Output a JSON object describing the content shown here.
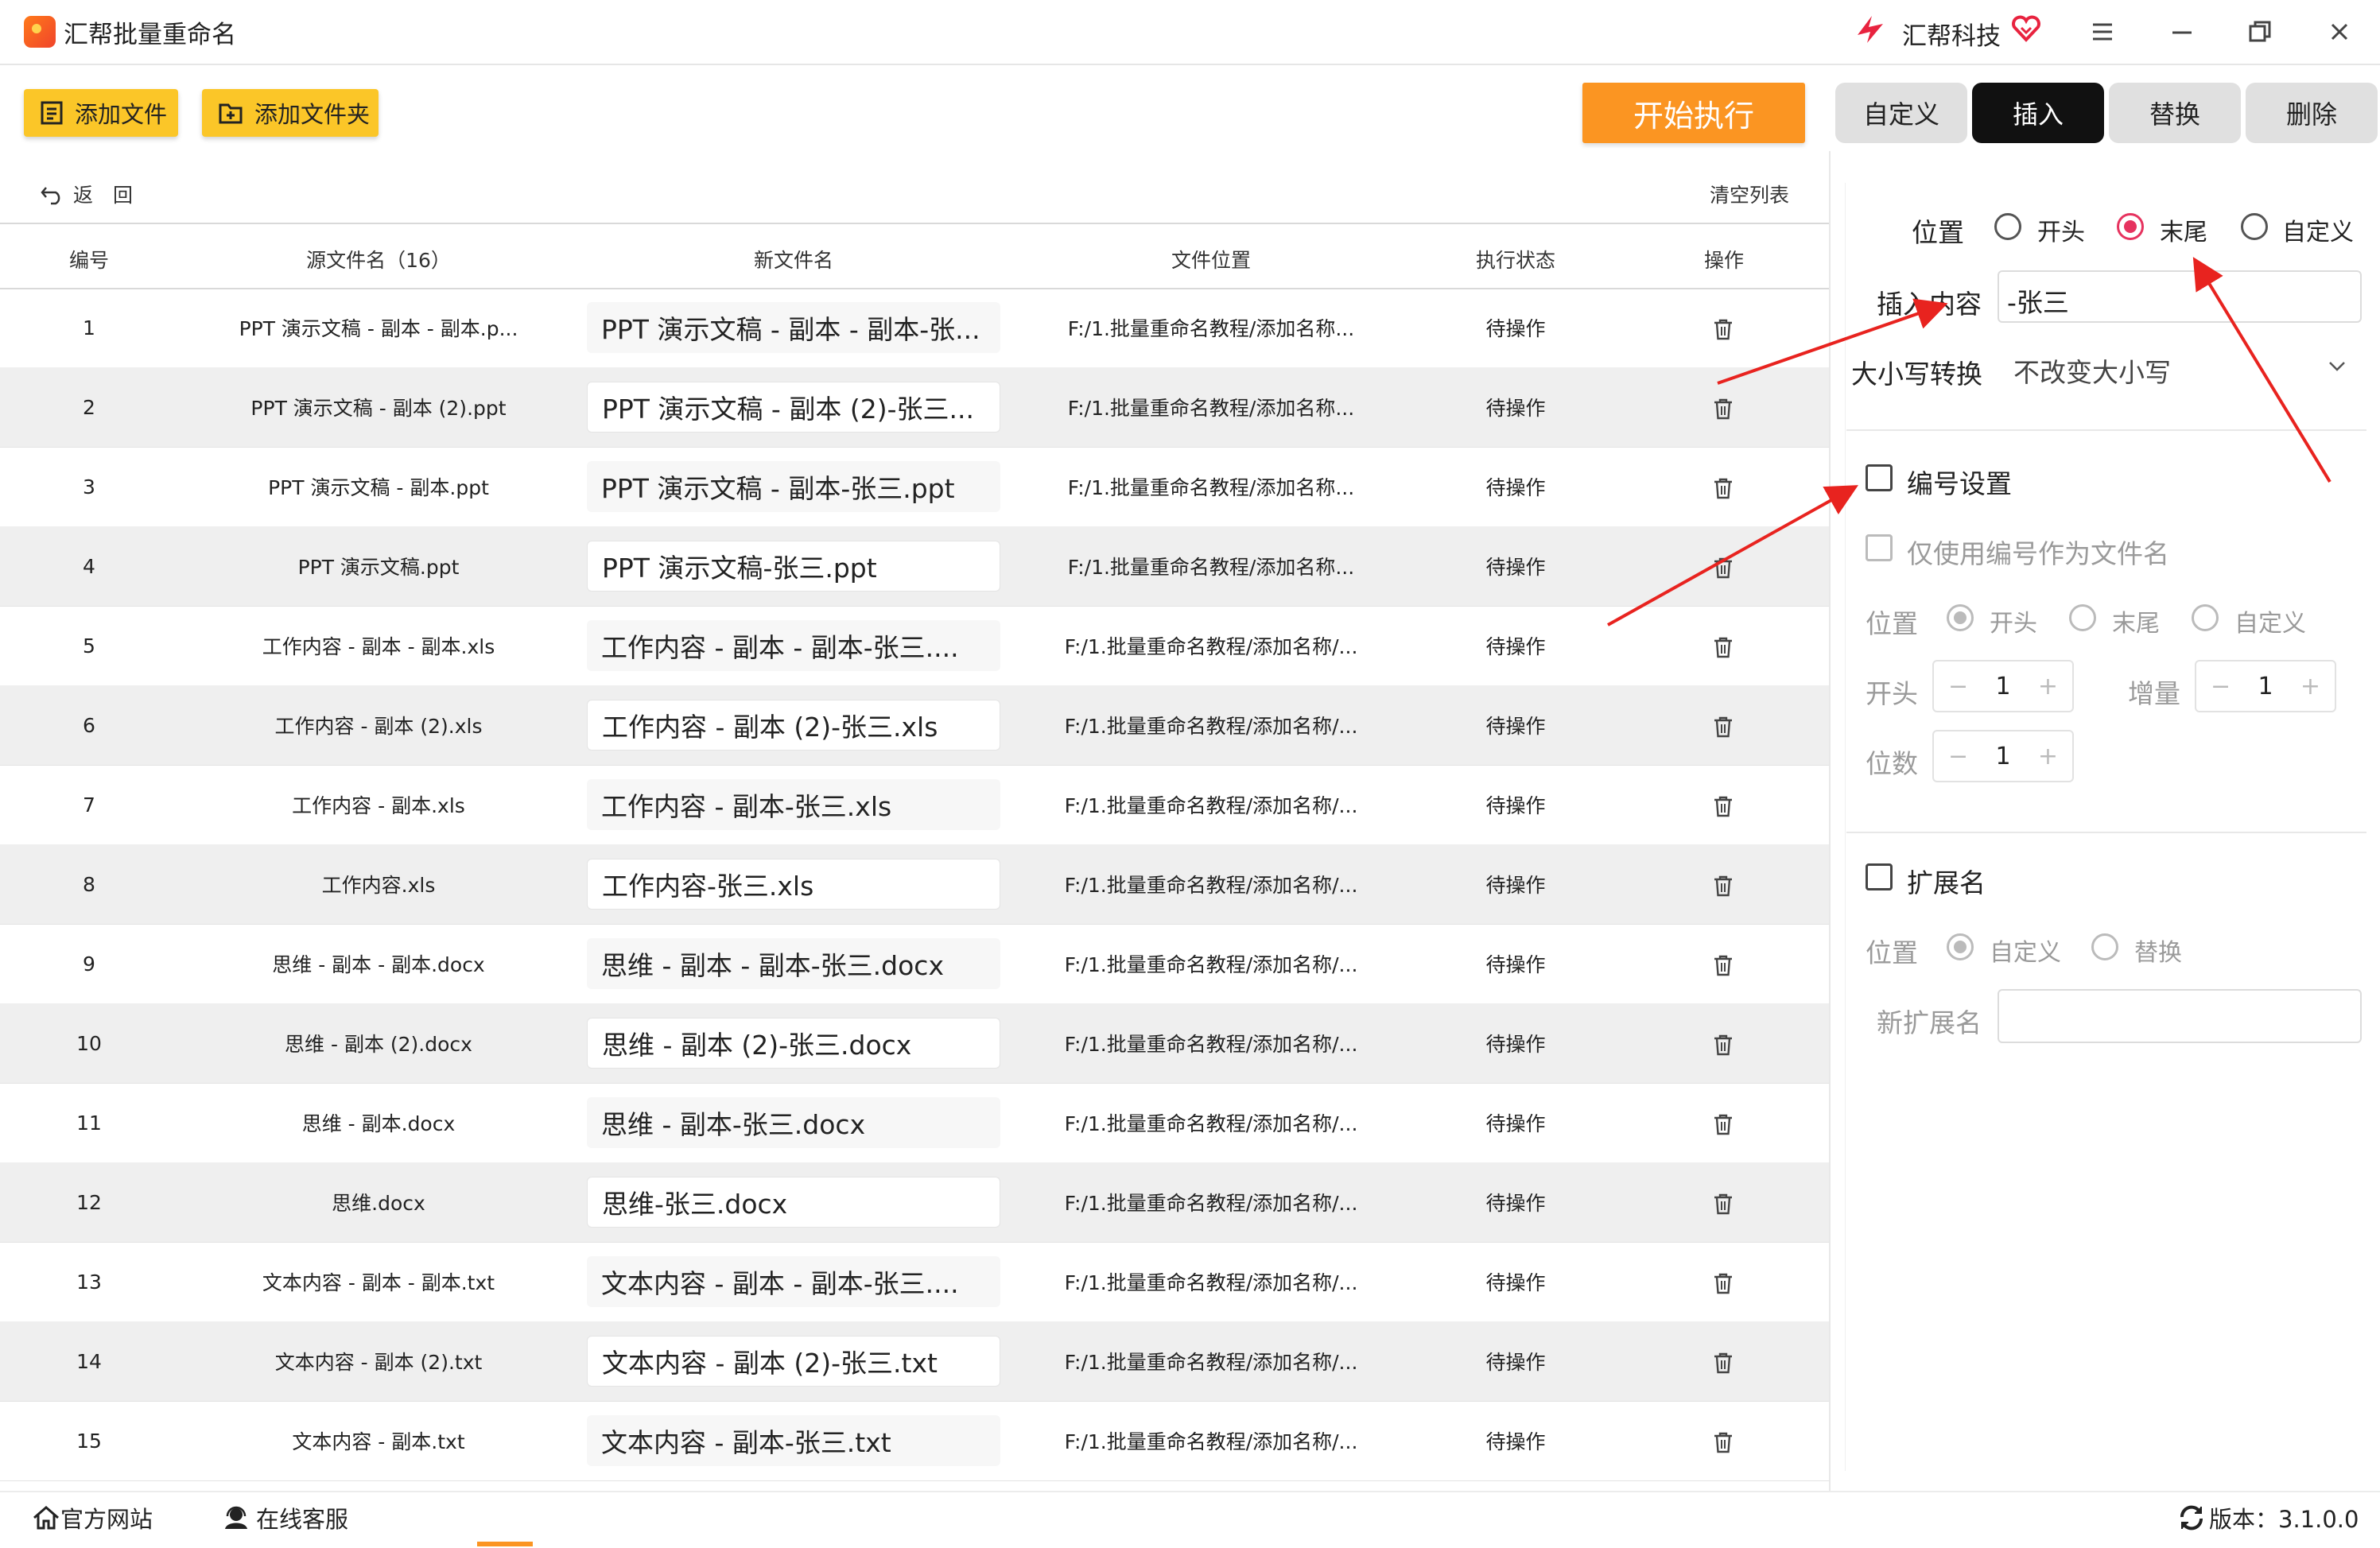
{
  "app": {
    "title": "汇帮批量重命名"
  },
  "brand": {
    "name": "汇帮科技"
  },
  "toolbar": {
    "add_file": "添加文件",
    "add_folder": "添加文件夹",
    "start": "开始执行"
  },
  "tabs": [
    {
      "label": "自定义",
      "active": false
    },
    {
      "label": "插入",
      "active": true
    },
    {
      "label": "替换",
      "active": false
    },
    {
      "label": "删除",
      "active": false
    }
  ],
  "list": {
    "back": "返　回",
    "clear": "清空列表",
    "columns": [
      "编号",
      "源文件名（16）",
      "新文件名",
      "文件位置",
      "执行状态",
      "操作"
    ],
    "rows": [
      {
        "num": "1",
        "src": "PPT 演示文稿 - 副本 - 副本.p...",
        "new": "PPT 演示文稿 - 副本 - 副本-张...",
        "loc": "F:/1.批量重命名教程/添加名称...",
        "status": "待操作"
      },
      {
        "num": "2",
        "src": "PPT 演示文稿 - 副本 (2).ppt",
        "new": "PPT 演示文稿 - 副本 (2)-张三...",
        "loc": "F:/1.批量重命名教程/添加名称...",
        "status": "待操作"
      },
      {
        "num": "3",
        "src": "PPT 演示文稿 - 副本.ppt",
        "new": "PPT 演示文稿 - 副本-张三.ppt",
        "loc": "F:/1.批量重命名教程/添加名称...",
        "status": "待操作"
      },
      {
        "num": "4",
        "src": "PPT 演示文稿.ppt",
        "new": "PPT 演示文稿-张三.ppt",
        "loc": "F:/1.批量重命名教程/添加名称...",
        "status": "待操作"
      },
      {
        "num": "5",
        "src": "工作内容 - 副本 - 副本.xls",
        "new": "工作内容 - 副本 - 副本-张三....",
        "loc": "F:/1.批量重命名教程/添加名称/...",
        "status": "待操作"
      },
      {
        "num": "6",
        "src": "工作内容 - 副本 (2).xls",
        "new": "工作内容 - 副本 (2)-张三.xls",
        "loc": "F:/1.批量重命名教程/添加名称/...",
        "status": "待操作"
      },
      {
        "num": "7",
        "src": "工作内容 - 副本.xls",
        "new": "工作内容 - 副本-张三.xls",
        "loc": "F:/1.批量重命名教程/添加名称/...",
        "status": "待操作"
      },
      {
        "num": "8",
        "src": "工作内容.xls",
        "new": "工作内容-张三.xls",
        "loc": "F:/1.批量重命名教程/添加名称/...",
        "status": "待操作"
      },
      {
        "num": "9",
        "src": "思维 - 副本 - 副本.docx",
        "new": "思维 - 副本 - 副本-张三.docx",
        "loc": "F:/1.批量重命名教程/添加名称/...",
        "status": "待操作"
      },
      {
        "num": "10",
        "src": "思维 - 副本 (2).docx",
        "new": "思维 - 副本 (2)-张三.docx",
        "loc": "F:/1.批量重命名教程/添加名称/...",
        "status": "待操作"
      },
      {
        "num": "11",
        "src": "思维 - 副本.docx",
        "new": "思维 - 副本-张三.docx",
        "loc": "F:/1.批量重命名教程/添加名称/...",
        "status": "待操作"
      },
      {
        "num": "12",
        "src": "思维.docx",
        "new": "思维-张三.docx",
        "loc": "F:/1.批量重命名教程/添加名称/...",
        "status": "待操作"
      },
      {
        "num": "13",
        "src": "文本内容 - 副本 - 副本.txt",
        "new": "文本内容 - 副本 - 副本-张三....",
        "loc": "F:/1.批量重命名教程/添加名称/...",
        "status": "待操作"
      },
      {
        "num": "14",
        "src": "文本内容 - 副本 (2).txt",
        "new": "文本内容 - 副本 (2)-张三.txt",
        "loc": "F:/1.批量重命名教程/添加名称/...",
        "status": "待操作"
      },
      {
        "num": "15",
        "src": "文本内容 - 副本.txt",
        "new": "文本内容 - 副本-张三.txt",
        "loc": "F:/1.批量重命名教程/添加名称/...",
        "status": "待操作"
      }
    ]
  },
  "panel": {
    "position_label": "位置",
    "position_options": [
      "开头",
      "末尾",
      "自定义"
    ],
    "position_selected": "末尾",
    "insert_label": "插入内容",
    "insert_value": "-张三",
    "case_label": "大小写转换",
    "case_value": "不改变大小写",
    "numbering": {
      "label": "编号设置",
      "only_number": "仅使用编号作为文件名",
      "position_label": "位置",
      "position_options": [
        "开头",
        "末尾",
        "自定义"
      ],
      "start_label": "开头",
      "start_value": "1",
      "increment_label": "增量",
      "increment_value": "1",
      "digits_label": "位数",
      "digits_value": "1",
      "minus": "−",
      "plus": "+"
    },
    "extension": {
      "label": "扩展名",
      "position_label": "位置",
      "position_options": [
        "自定义",
        "替换"
      ],
      "new_label": "新扩展名",
      "new_value": ""
    }
  },
  "footer": {
    "website": "官方网站",
    "support": "在线客服",
    "version": "版本：3.1.0.0"
  },
  "colors": {
    "accent_orange": "#fb9522",
    "button_yellow": "#fbc628",
    "radio_pink": "#e6335f",
    "arrow_red": "#e8231f"
  }
}
